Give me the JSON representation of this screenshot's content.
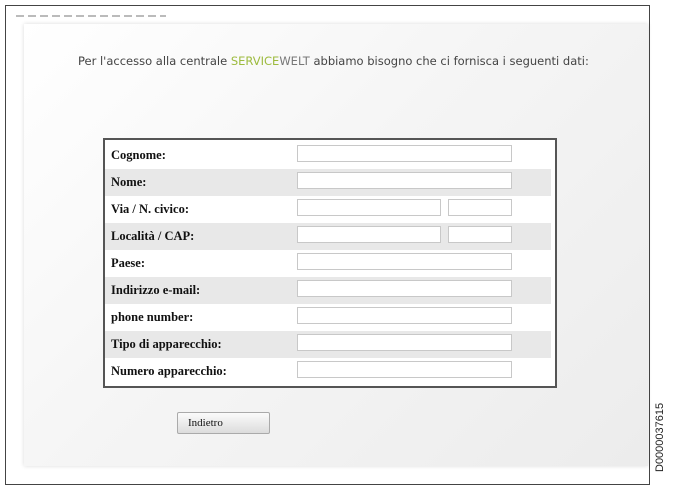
{
  "intro": {
    "prefix": "Per l'accesso alla centrale ",
    "brand_part1": "SERVICE",
    "brand_part2": "WELT",
    "suffix": " abbiamo bisogno che ci fornisca i seguenti dati:"
  },
  "form": {
    "fields": [
      {
        "label": "Cognome:",
        "value": "",
        "placeholder": ""
      },
      {
        "label": "Nome:",
        "value": "",
        "placeholder": ""
      },
      {
        "label": "Via / N. civico:",
        "value": "",
        "value2": ""
      },
      {
        "label": "Località / CAP:",
        "value": "",
        "value2": ""
      },
      {
        "label": "Paese:",
        "value": ""
      },
      {
        "label": "Indirizzo e-mail:",
        "value": ""
      },
      {
        "label": "phone number:",
        "value": ""
      },
      {
        "label": "Tipo di apparecchio:",
        "value": ""
      },
      {
        "label": "Numero apparecchio:",
        "value": ""
      }
    ]
  },
  "buttons": {
    "back_label": "Indietro"
  },
  "document_id": "D0000037615",
  "colors": {
    "brand_green": "#9dbb3e",
    "brand_gray": "#777777",
    "alt_row": "#e8e8e8"
  }
}
